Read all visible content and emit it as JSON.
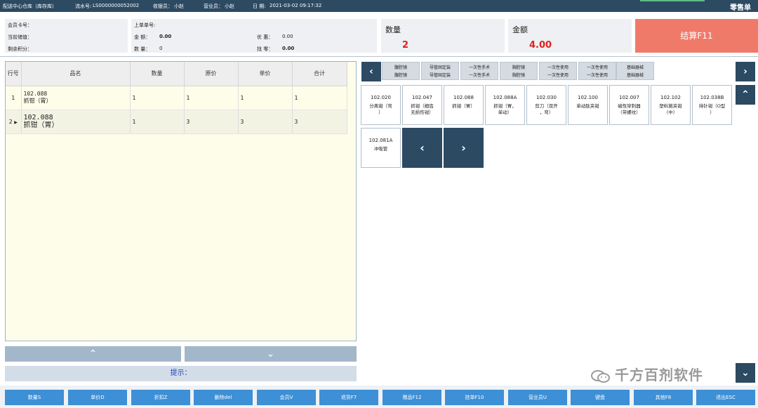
{
  "top": {
    "warehouse": "配送中心仓库（库存库）",
    "serial_label": "流水号:",
    "serial": "LS0000000052002",
    "cashier_label": "收银员：",
    "cashier": "小赵",
    "sales_label": "营业员：",
    "sales": "小赵",
    "date_label": "日  期:",
    "date": "2021-03-02 09:17:32",
    "title": "零售单"
  },
  "member": {
    "card_label": "会员卡号：",
    "balance_label": "当前储值：",
    "points_label": "剩余积分："
  },
  "last": {
    "order_label": "上单单号:",
    "amount_label": "金    额：",
    "amount": "0.00",
    "qty_label": "数    量：",
    "qty": "0",
    "discount_label": "优    惠：",
    "discount": "0.00",
    "change_label": "找    零：",
    "change": "0.00"
  },
  "summary": {
    "qty_label": "数量",
    "qty": "2",
    "amt_label": "金额",
    "amt": "4.00",
    "checkout": "结算F11"
  },
  "grid": {
    "columns": [
      "行号",
      "品名",
      "数量",
      "原价",
      "单价",
      "合计"
    ],
    "rows": [
      {
        "idx": "1",
        "code": "102.088",
        "name": "抓钳（胃）",
        "qty": "1",
        "orig": "1",
        "price": "1",
        "total": "1"
      },
      {
        "idx": "2",
        "code": "102.088",
        "name": "抓钳（胃）",
        "qty": "1",
        "orig": "3",
        "price": "3",
        "total": "3"
      }
    ]
  },
  "hint": "提示：",
  "categories": [
    {
      "a": "腹腔镜",
      "b": "腹腔镜"
    },
    {
      "a": "导管固定装",
      "b": "导管固定装"
    },
    {
      "a": "一次性手术",
      "b": "一次性手术"
    },
    {
      "a": "胸腔镜",
      "b": "胸腔镜"
    },
    {
      "a": "一次性使用",
      "b": "一次性使用"
    },
    {
      "a": "一次性使用",
      "b": "一次性使用"
    },
    {
      "a": "基础器械",
      "b": "基础器械"
    }
  ],
  "products": [
    {
      "code": "102.020",
      "name": "分离钳（弯\n）"
    },
    {
      "code": "102.047",
      "name": "抓钳（细齿\n无损伤钳）"
    },
    {
      "code": "102.088",
      "name": "抓钳（胃）"
    },
    {
      "code": "102.088A",
      "name": "抓钳（胃，\n单动）"
    },
    {
      "code": "102.030",
      "name": "剪刀（双开\n，弯）"
    },
    {
      "code": "102.100",
      "name": "单动肽夹钳"
    },
    {
      "code": "102.007",
      "name": "磁性穿刺器\n（带螺纹）"
    },
    {
      "code": "102.102",
      "name": "塑料施夹钳\n（中）"
    },
    {
      "code": "102.038B",
      "name": "持针钳（O型\n）"
    },
    {
      "code": "102.081A",
      "name": "冲吸管"
    }
  ],
  "fkeys": [
    "数量S",
    "单价D",
    "折扣Z",
    "删除del",
    "会员V",
    "退货F7",
    "赠品F12",
    "挂单F10",
    "营业员U",
    "键盘",
    "其他F8",
    "退出ESC"
  ],
  "icons": {
    "left": "chevron-left-icon",
    "right": "chevron-right-icon",
    "up": "chevron-up-icon",
    "down": "chevron-down-icon"
  },
  "colors": {
    "titlebar": "#2c4a62",
    "checkout": "#f07a6a",
    "fkey": "#3d8fd6",
    "grid_bg": "#fefdea",
    "accent_red": "#e02020"
  },
  "watermark": "千方百剂软件"
}
